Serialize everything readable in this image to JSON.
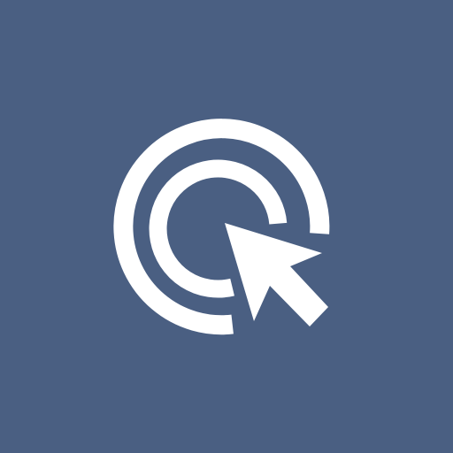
{
  "icon": {
    "name": "click-target-cursor-icon",
    "background_color": "#4a5f82",
    "foreground_color": "#ffffff"
  }
}
